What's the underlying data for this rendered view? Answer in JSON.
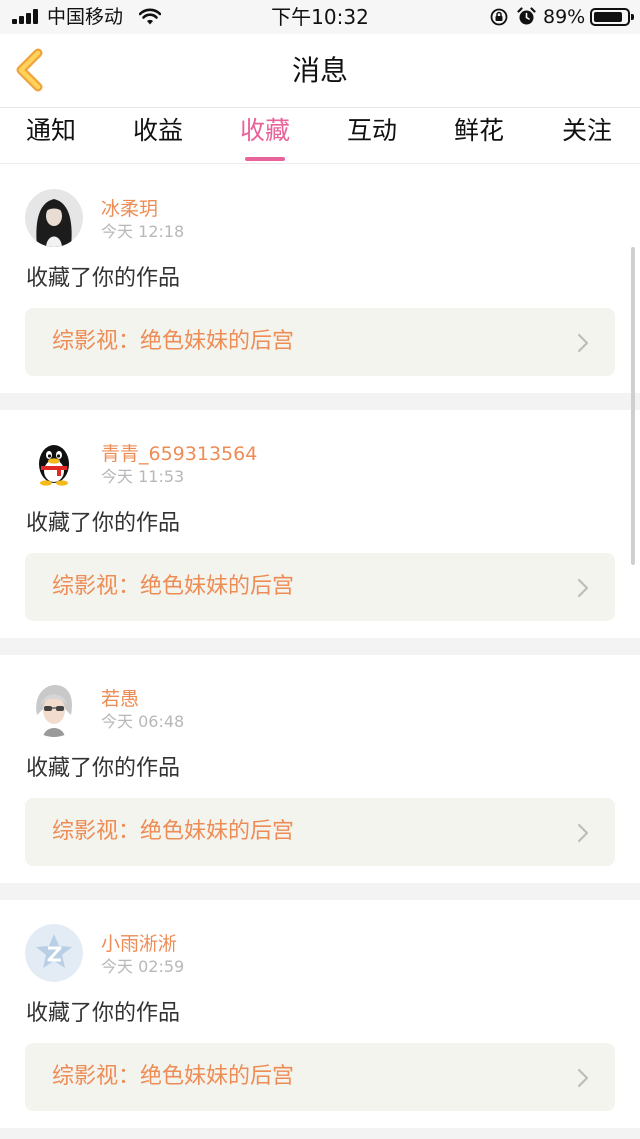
{
  "status_bar": {
    "carrier": "中国移动",
    "time": "下午10:32",
    "battery_percent": "89%",
    "battery_level": 0.89,
    "icons": [
      "signal-icon",
      "wifi-icon",
      "rotation-lock-icon",
      "alarm-icon",
      "battery-icon"
    ]
  },
  "nav": {
    "title": "消息",
    "back_icon": "chevron-left-icon"
  },
  "tabs": [
    {
      "label": "通知",
      "active": false
    },
    {
      "label": "收益",
      "active": false
    },
    {
      "label": "收藏",
      "active": true
    },
    {
      "label": "互动",
      "active": false
    },
    {
      "label": "鲜花",
      "active": false
    },
    {
      "label": "关注",
      "active": false
    }
  ],
  "notifications": [
    {
      "username": "冰柔玥",
      "time": "今天 12:18",
      "message": "收藏了你的作品",
      "work_title": "综影视：绝色妹妹的后宫",
      "avatar": "long-hair-avatar"
    },
    {
      "username": "青青_659313564",
      "time": "今天 11:53",
      "message": "收藏了你的作品",
      "work_title": "综影视：绝色妹妹的后宫",
      "avatar": "qq-penguin-avatar"
    },
    {
      "username": "若愚",
      "time": "今天 06:48",
      "message": "收藏了你的作品",
      "work_title": "综影视：绝色妹妹的后宫",
      "avatar": "silver-hair-avatar"
    },
    {
      "username": "小雨淅淅",
      "time": "今天 02:59",
      "message": "收藏了你的作品",
      "work_title": "综影视：绝色妹妹的后宫",
      "avatar": "default-z-avatar"
    }
  ],
  "colors": {
    "accent_pink": "#e8639a",
    "username_orange": "#ee8c55",
    "link_bg": "#f4f4ee"
  }
}
